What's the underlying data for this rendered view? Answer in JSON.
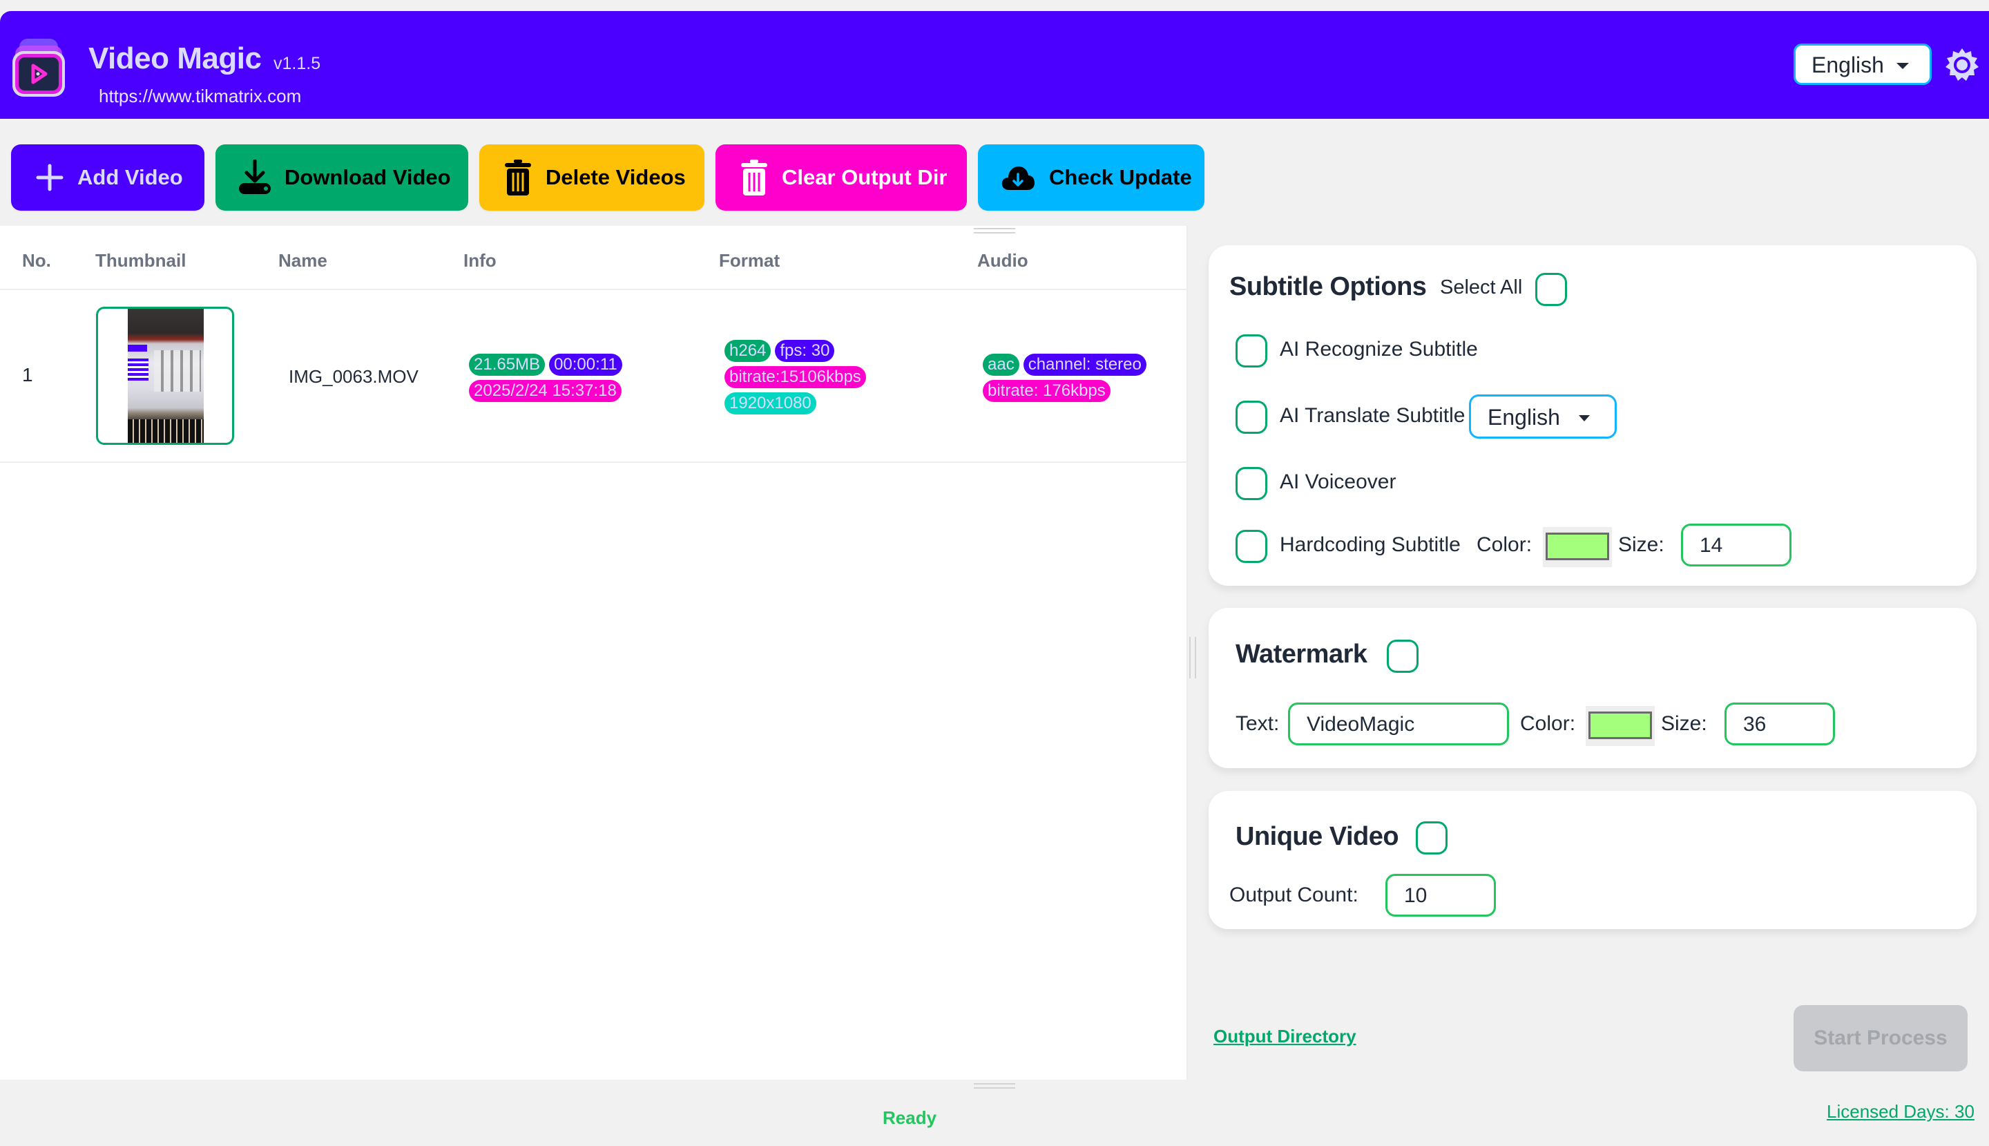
{
  "header": {
    "app_name": "Video Magic",
    "version": "v1.1.5",
    "url": "https://www.tikmatrix.com",
    "language": "English",
    "icons": {
      "logo": "video-stack-play-logo",
      "settings": "gear-icon"
    }
  },
  "toolbar": {
    "buttons": [
      {
        "label": "Add Video",
        "icon": "plus-icon",
        "color": "#4B00FF"
      },
      {
        "label": "Download Video",
        "icon": "download-icon",
        "color": "#00A86B"
      },
      {
        "label": "Delete Videos",
        "icon": "trash-icon",
        "color": "#FFC107"
      },
      {
        "label": "Clear Output Dir",
        "icon": "trash-icon",
        "color": "#FF00CC"
      },
      {
        "label": "Check Update",
        "icon": "cloud-download-icon",
        "color": "#00B7FF"
      }
    ]
  },
  "table": {
    "columns": [
      "No.",
      "Thumbnail",
      "Name",
      "Info",
      "Format",
      "Audio"
    ],
    "rows": [
      {
        "no": "1",
        "name": "IMG_0063.MOV",
        "info": {
          "size": "21.65MB",
          "duration": "00:00:11",
          "date": "2025/2/24 15:37:18"
        },
        "format": {
          "codec": "h264",
          "fps": "fps: 30",
          "bitrate": "bitrate:15106kbps",
          "resolution": "1920x1080"
        },
        "audio": {
          "codec": "aac",
          "channel": "channel: stereo",
          "bitrate": "bitrate: 176kbps"
        }
      }
    ]
  },
  "subtitle_options": {
    "title": "Subtitle Options",
    "select_all_label": "Select All",
    "select_all_checked": false,
    "ai_recognize": {
      "label": "AI Recognize Subtitle",
      "checked": false
    },
    "ai_translate": {
      "label": "AI Translate Subtitle",
      "checked": false,
      "language": "English"
    },
    "ai_voiceover": {
      "label": "AI Voiceover",
      "checked": false
    },
    "hardcoding": {
      "label": "Hardcoding Subtitle",
      "checked": false,
      "color_label": "Color:",
      "color": "#A4FF7C",
      "size_label": "Size:",
      "size": "14"
    }
  },
  "watermark": {
    "title": "Watermark",
    "checked": false,
    "text_label": "Text:",
    "text": "VideoMagic",
    "color_label": "Color:",
    "color": "#A4FF7C",
    "size_label": "Size:",
    "size": "36"
  },
  "unique_video": {
    "title": "Unique Video",
    "checked": false,
    "output_count_label": "Output Count:",
    "output_count": "10"
  },
  "footer_actions": {
    "output_directory": "Output Directory",
    "start_process": "Start Process",
    "start_process_enabled": false
  },
  "status_bar": {
    "status": "Ready",
    "license": "Licensed Days: 30"
  },
  "colors": {
    "primary": "#4B00FF",
    "green": "#00A86B",
    "yellow": "#FFC107",
    "pink": "#FF00CC",
    "cyan": "#00B7FF",
    "teal": "#00D6C0",
    "status_ok": "#22c55e"
  }
}
